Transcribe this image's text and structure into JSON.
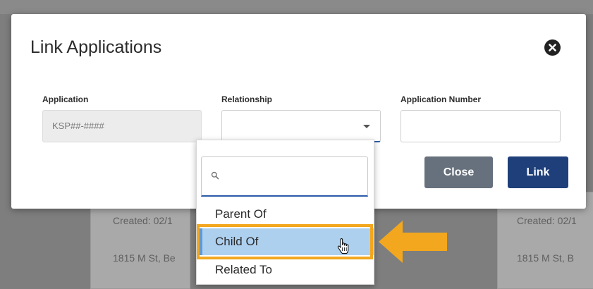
{
  "modal": {
    "title": "Link Applications",
    "fields": {
      "application": {
        "label": "Application",
        "value": "KSP##-####"
      },
      "relationship": {
        "label": "Relationship",
        "value": ""
      },
      "application_number": {
        "label": "Application Number",
        "value": ""
      }
    },
    "buttons": {
      "close": "Close",
      "link": "Link"
    }
  },
  "dropdown": {
    "search_value": "",
    "options": [
      {
        "label": "Parent Of",
        "selected": false
      },
      {
        "label": "Child Of",
        "selected": true
      },
      {
        "label": "Related To",
        "selected": false
      }
    ]
  },
  "background": {
    "cards": [
      {
        "created": "Created: 02/1",
        "address": "1815 M St, Be"
      },
      {
        "created": "Created: 02/1",
        "address": "1815 M St, B"
      }
    ]
  },
  "colors": {
    "primary": "#1e3f7a",
    "secondary": "#67717d",
    "selected_option": "#aed0ef",
    "callout": "#f2a71e",
    "focus_underline": "#2b5ba8"
  },
  "icons": {
    "close": "close-circle-icon",
    "search": "search-icon",
    "caret": "chevron-down-icon",
    "cursor": "hand-pointer-icon",
    "callout": "arrow-left-icon"
  }
}
